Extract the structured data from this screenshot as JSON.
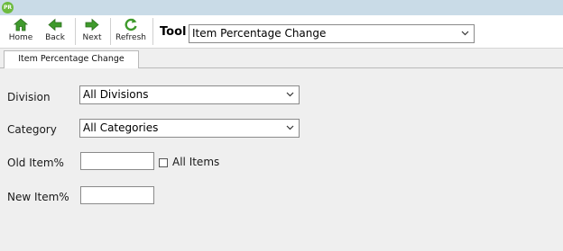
{
  "app": {
    "logo_text": "PR"
  },
  "toolbar": {
    "buttons": [
      {
        "label": "Home",
        "icon": "home-icon"
      },
      {
        "label": "Back",
        "icon": "back-arrow-icon"
      },
      {
        "label": "Next",
        "icon": "next-arrow-icon"
      },
      {
        "label": "Refresh",
        "icon": "refresh-icon"
      }
    ],
    "tool_label": "Tool",
    "tool_select_value": "Item Percentage Change"
  },
  "tabs": [
    {
      "label": "Item Percentage Change",
      "active": true
    }
  ],
  "form": {
    "division": {
      "label": "Division",
      "value": "All Divisions"
    },
    "category": {
      "label": "Category",
      "value": "All Categories"
    },
    "old_item": {
      "label": "Old Item%",
      "value": "",
      "checkbox_label": "All Items",
      "checked": false
    },
    "new_item": {
      "label": "New Item%",
      "value": ""
    }
  },
  "colors": {
    "titlebar": "#c9dbe7",
    "arrow_green": "#3f9a2c",
    "background": "#efefef"
  }
}
